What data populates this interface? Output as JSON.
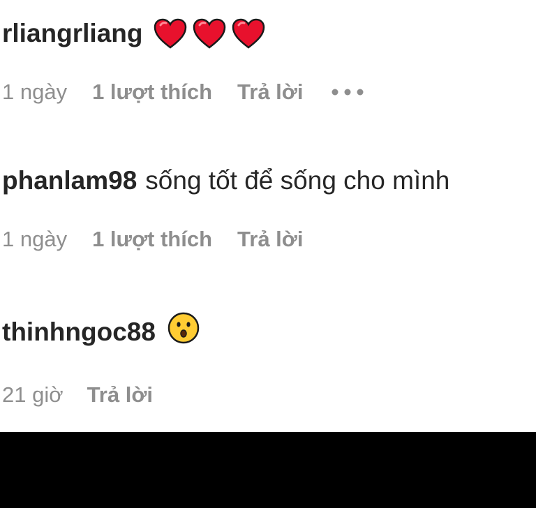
{
  "comments": [
    {
      "username": "rliangrliang",
      "text": "",
      "emojis": [
        "heart-icon",
        "heart-icon",
        "heart-icon"
      ],
      "time": "1 ngày",
      "likes": "1 lượt thích",
      "reply": "Trả lời",
      "has_more": true
    },
    {
      "username": "phanlam98",
      "text": "sống tốt để sống cho mình",
      "emojis": [],
      "time": "1 ngày",
      "likes": "1 lượt thích",
      "reply": "Trả lời",
      "has_more": false
    },
    {
      "username": "thinhngoc88",
      "text": "",
      "emojis": [
        "surprised-face-icon"
      ],
      "time": "21 giờ",
      "likes": "",
      "reply": "Trả lời",
      "has_more": false
    }
  ],
  "colors": {
    "text_primary": "#262626",
    "text_secondary": "#8e8e8e",
    "heart": "#e8112d",
    "emoji_face": "#ffcc33",
    "bottom_bar": "#000000"
  }
}
